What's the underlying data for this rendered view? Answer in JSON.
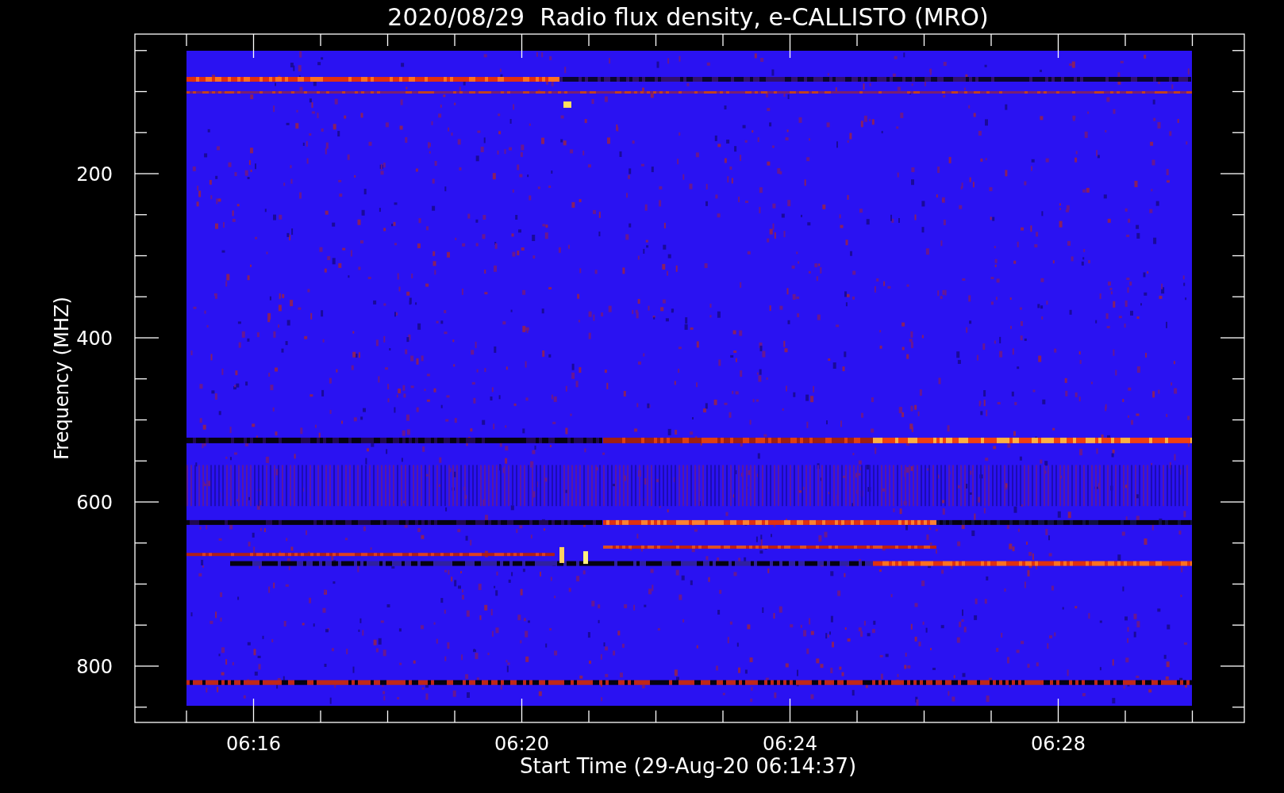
{
  "title": "2020/08/29  Radio flux density, e-CALLISTO (MRO)",
  "ylabel": "Frequency (MHZ)",
  "xlabel": "Start Time (29-Aug-20 06:14:37)",
  "yticks": [
    "200",
    "400",
    "600",
    "800"
  ],
  "xticks": [
    "06:16",
    "06:20",
    "06:24",
    "06:28"
  ]
}
